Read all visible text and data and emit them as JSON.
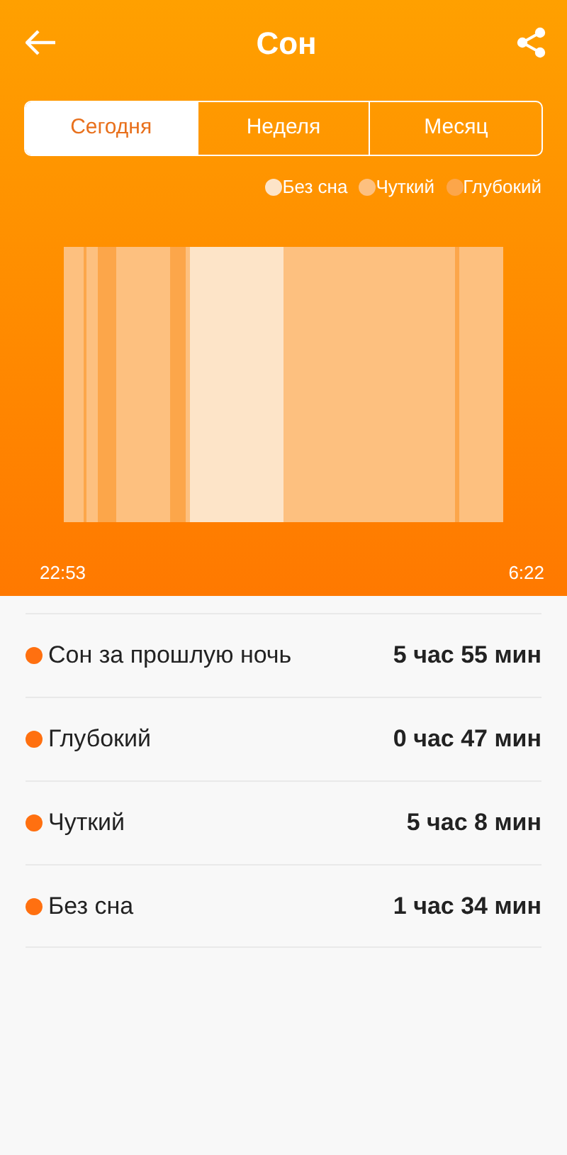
{
  "header": {
    "title": "Сон"
  },
  "tabs": [
    {
      "label": "Сегодня",
      "selected": true
    },
    {
      "label": "Неделя",
      "selected": false
    },
    {
      "label": "Месяц",
      "selected": false
    }
  ],
  "legend": [
    {
      "label": "Без сна",
      "color": "#fde4c8"
    },
    {
      "label": "Чуткий",
      "color": "#fdc07f"
    },
    {
      "label": "Глубокий",
      "color": "#fca64a"
    }
  ],
  "chart": {
    "start_time": "22:53",
    "end_time": "6:22"
  },
  "stats": [
    {
      "label": "Сон за прошлую ночь",
      "value": "5 час 55 мин",
      "color": "#ff7010"
    },
    {
      "label": "Глубокий",
      "value": "0 час 47 мин",
      "color": "#ff7010"
    },
    {
      "label": "Чуткий",
      "value": "5 час 8 мин",
      "color": "#ff7010"
    },
    {
      "label": "Без сна",
      "value": "1 час 34 мин",
      "color": "#ff7010"
    }
  ]
}
